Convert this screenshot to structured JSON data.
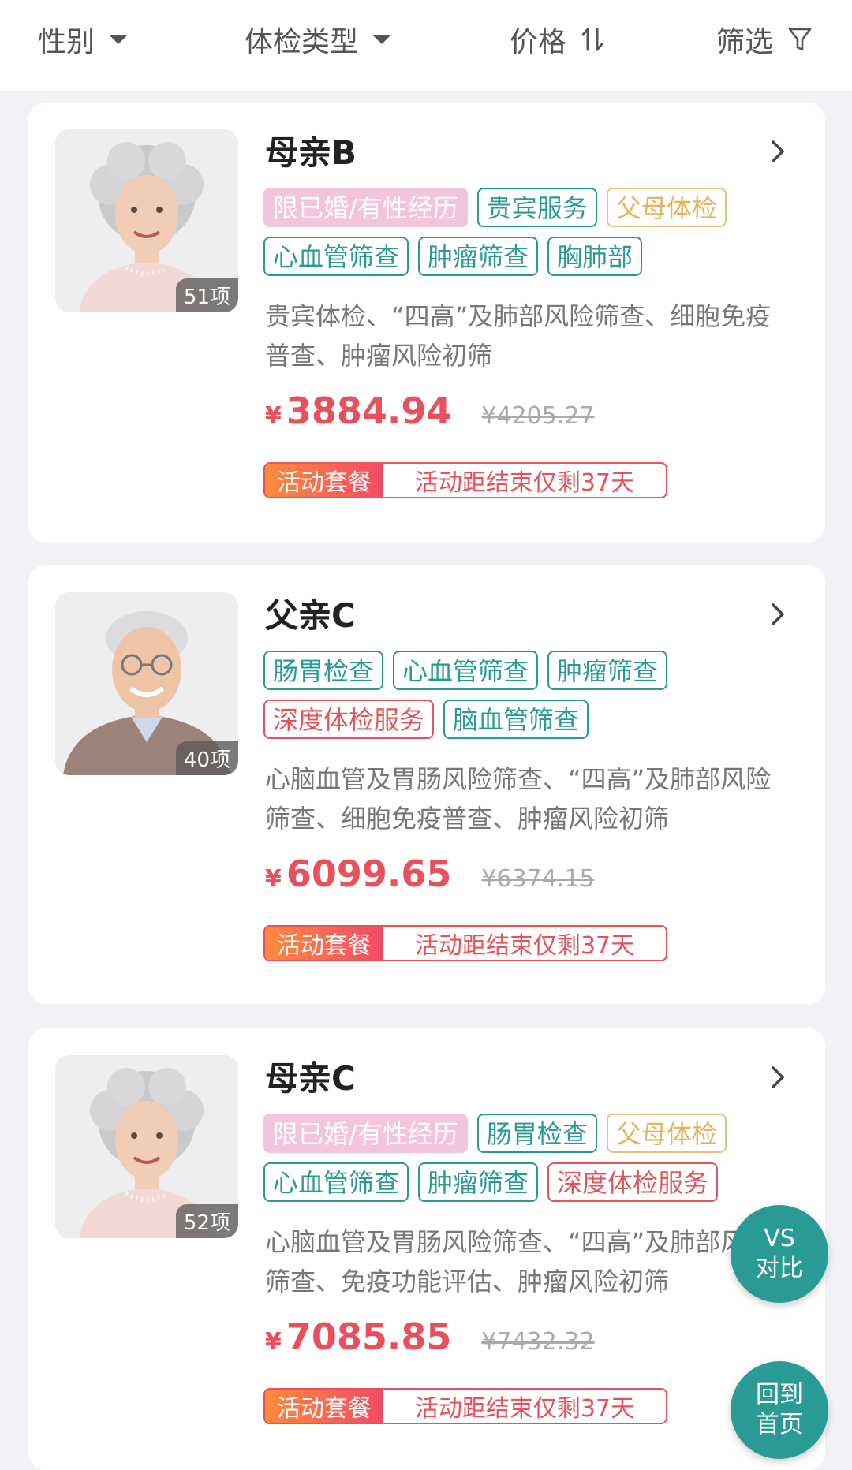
{
  "filters": {
    "gender": "性别",
    "exam_type": "体检类型",
    "price": "价格",
    "filter": "筛选"
  },
  "packages": [
    {
      "title": "母亲B",
      "count": "51项",
      "tags": [
        {
          "label": "限已婚/有性经历",
          "style": "pink"
        },
        {
          "label": "贵宾服务",
          "style": "teal"
        },
        {
          "label": "父母体检",
          "style": "gold"
        },
        {
          "label": "心血管筛查",
          "style": "teal"
        },
        {
          "label": "肿瘤筛查",
          "style": "teal"
        },
        {
          "label": "胸肺部",
          "style": "teal"
        }
      ],
      "description": "贵宾体检、“四高”及肺部风险筛查、细胞免疫普查、肿瘤风险初筛",
      "currency": "¥",
      "price": "3884.94",
      "original_price": "¥4205.27",
      "promo_tag": "活动套餐",
      "promo_text": "活动距结束仅剩37天",
      "avatar": "elderly-woman"
    },
    {
      "title": "父亲C",
      "count": "40项",
      "tags": [
        {
          "label": "肠胃检查",
          "style": "teal"
        },
        {
          "label": "心血管筛查",
          "style": "teal"
        },
        {
          "label": "肿瘤筛查",
          "style": "teal"
        },
        {
          "label": "深度体检服务",
          "style": "red"
        },
        {
          "label": "脑血管筛查",
          "style": "teal"
        }
      ],
      "description": "心脑血管及胃肠风险筛查、“四高”及肺部风险筛查、细胞免疫普查、肿瘤风险初筛",
      "currency": "¥",
      "price": "6099.65",
      "original_price": "¥6374.15",
      "promo_tag": "活动套餐",
      "promo_text": "活动距结束仅剩37天",
      "avatar": "elderly-man"
    },
    {
      "title": "母亲C",
      "count": "52项",
      "tags": [
        {
          "label": "限已婚/有性经历",
          "style": "pink"
        },
        {
          "label": "肠胃检查",
          "style": "teal"
        },
        {
          "label": "父母体检",
          "style": "gold"
        },
        {
          "label": "心血管筛查",
          "style": "teal"
        },
        {
          "label": "肿瘤筛查",
          "style": "teal"
        },
        {
          "label": "深度体检服务",
          "style": "red"
        }
      ],
      "description": "心脑血管及胃肠风险筛查、“四高”及肺部风险筛查、免疫功能评估、肿瘤风险初筛",
      "currency": "¥",
      "price": "7085.85",
      "original_price": "¥7432.32",
      "promo_tag": "活动套餐",
      "promo_text": "活动距结束仅剩37天",
      "avatar": "elderly-woman"
    }
  ],
  "fab": {
    "compare_line1": "VS",
    "compare_line2": "对比",
    "home_line1": "回到",
    "home_line2": "首页"
  },
  "colors": {
    "accent_teal": "#2a9a94",
    "price_red": "#e8505b",
    "tag_pink": "#f3c5dc",
    "tag_gold": "#e5b35e"
  }
}
